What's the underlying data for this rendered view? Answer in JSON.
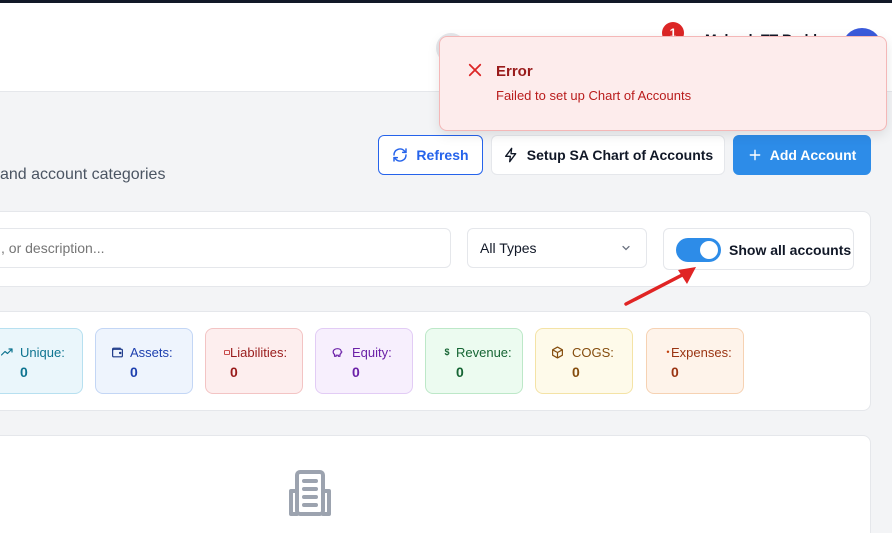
{
  "header": {
    "notification_count": "1",
    "user_name": "Mahesh TT Reddy"
  },
  "toast": {
    "title": "Error",
    "message": "Failed to set up Chart of Accounts"
  },
  "page": {
    "subtitle": "and account categories"
  },
  "actions": {
    "refresh_label": "Refresh",
    "setup_label": "Setup SA Chart of Accounts",
    "add_label": "Add Account"
  },
  "filters": {
    "search_placeholder": ", or description...",
    "type_selected": "All Types",
    "show_all_label": "Show all accounts",
    "show_all_on": true
  },
  "stats": [
    {
      "label": "Unique:",
      "value": "0",
      "icon": "trend-icon",
      "color": "#0e7490"
    },
    {
      "label": "Assets:",
      "value": "0",
      "icon": "wallet-icon",
      "color": "#1e40af"
    },
    {
      "label": "Liabilities:",
      "value": "0",
      "icon": "credit-card-icon",
      "color": "#991b1b"
    },
    {
      "label": "Equity:",
      "value": "0",
      "icon": "piggy-bank-icon",
      "color": "#6b21a8"
    },
    {
      "label": "Revenue:",
      "value": "0",
      "icon": "dollar-icon",
      "color": "#166534"
    },
    {
      "label": "COGS:",
      "value": "0",
      "icon": "package-icon",
      "color": "#854d0e"
    },
    {
      "label": "Expenses:",
      "value": "0",
      "icon": "receipt-icon",
      "color": "#9a3412"
    }
  ],
  "colors": {
    "primary": "#2d8ce8",
    "error_bg": "#fdecec",
    "error_text": "#991b1b",
    "annotation_arrow": "#e02424"
  }
}
